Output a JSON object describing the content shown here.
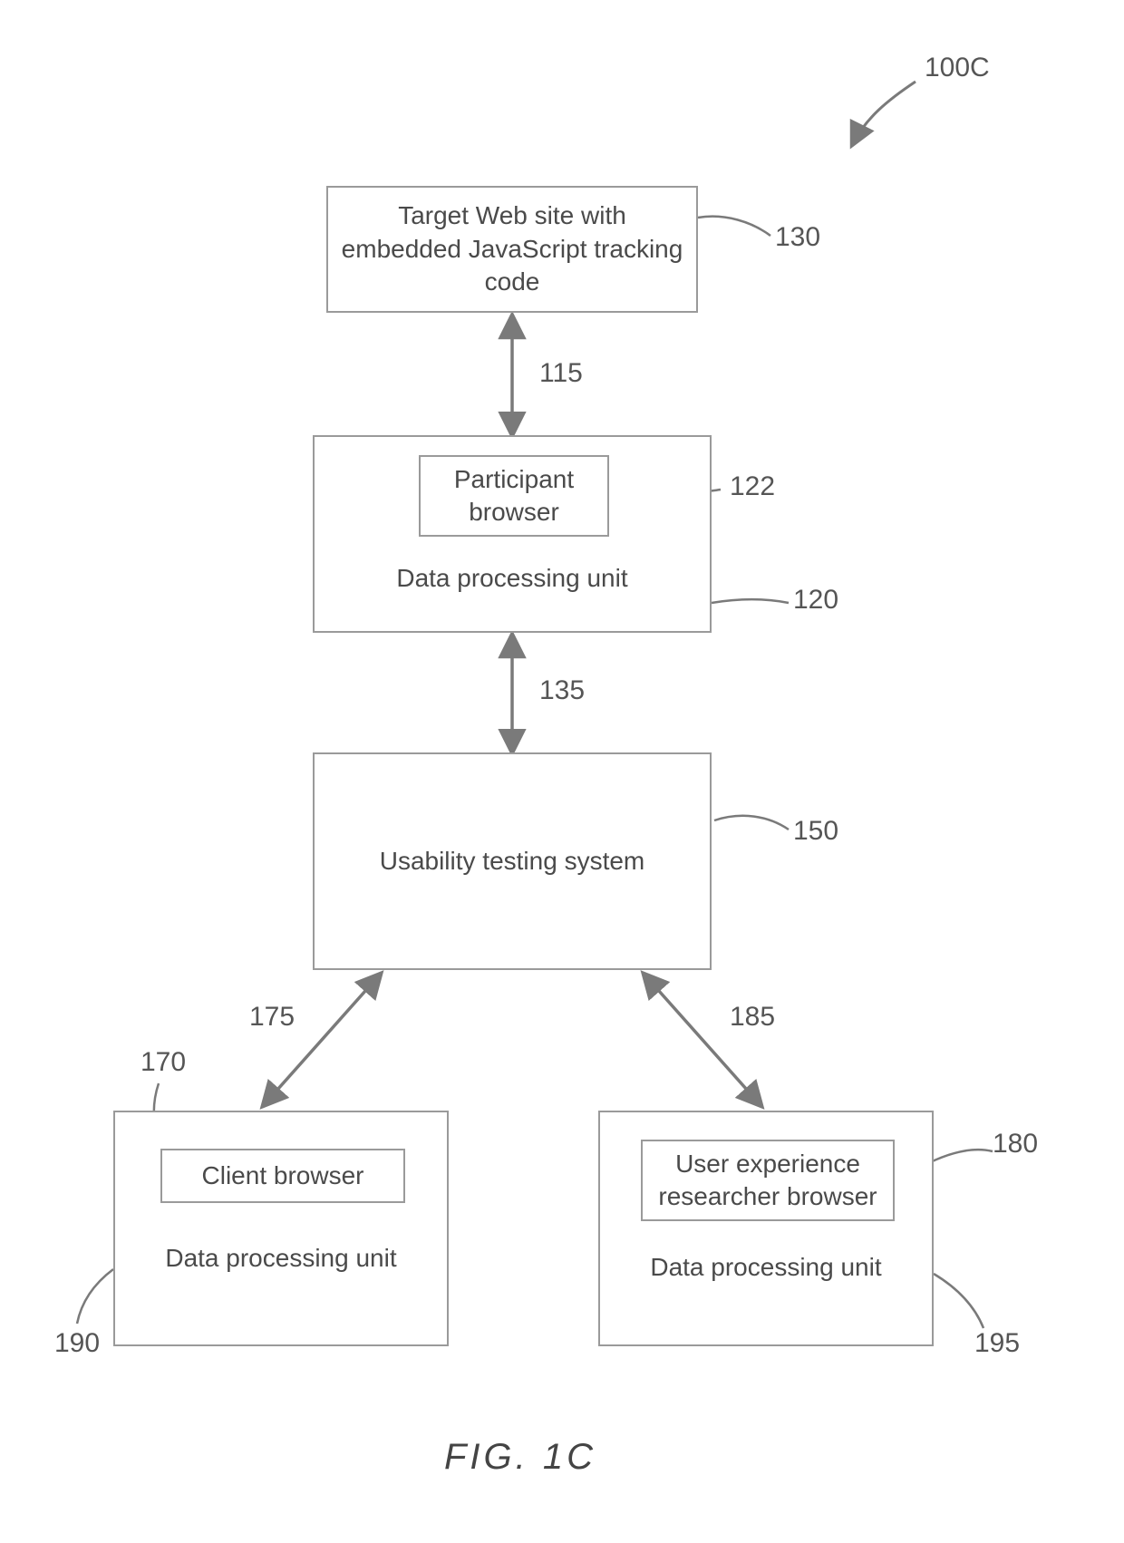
{
  "figure_id": "100C",
  "figure_title": "FIG. 1C",
  "boxes": {
    "target_web_site": {
      "text": "Target Web site with embedded JavaScript tracking code",
      "ref": "130"
    },
    "participant_dpu": {
      "outer_text": "Data processing unit",
      "inner_text": "Participant browser",
      "outer_ref": "120",
      "inner_ref": "122"
    },
    "usability": {
      "text": "Usability testing system",
      "ref": "150"
    },
    "client_dpu": {
      "outer_text": "Data processing unit",
      "inner_text": "Client browser",
      "outer_ref": "190",
      "inner_ref": "170"
    },
    "ux_dpu": {
      "outer_text": "Data processing unit",
      "inner_text": "User experience researcher browser",
      "outer_ref": "195",
      "inner_ref": "180"
    }
  },
  "connectors": {
    "c115": "115",
    "c135": "135",
    "c175": "175",
    "c185": "185"
  }
}
